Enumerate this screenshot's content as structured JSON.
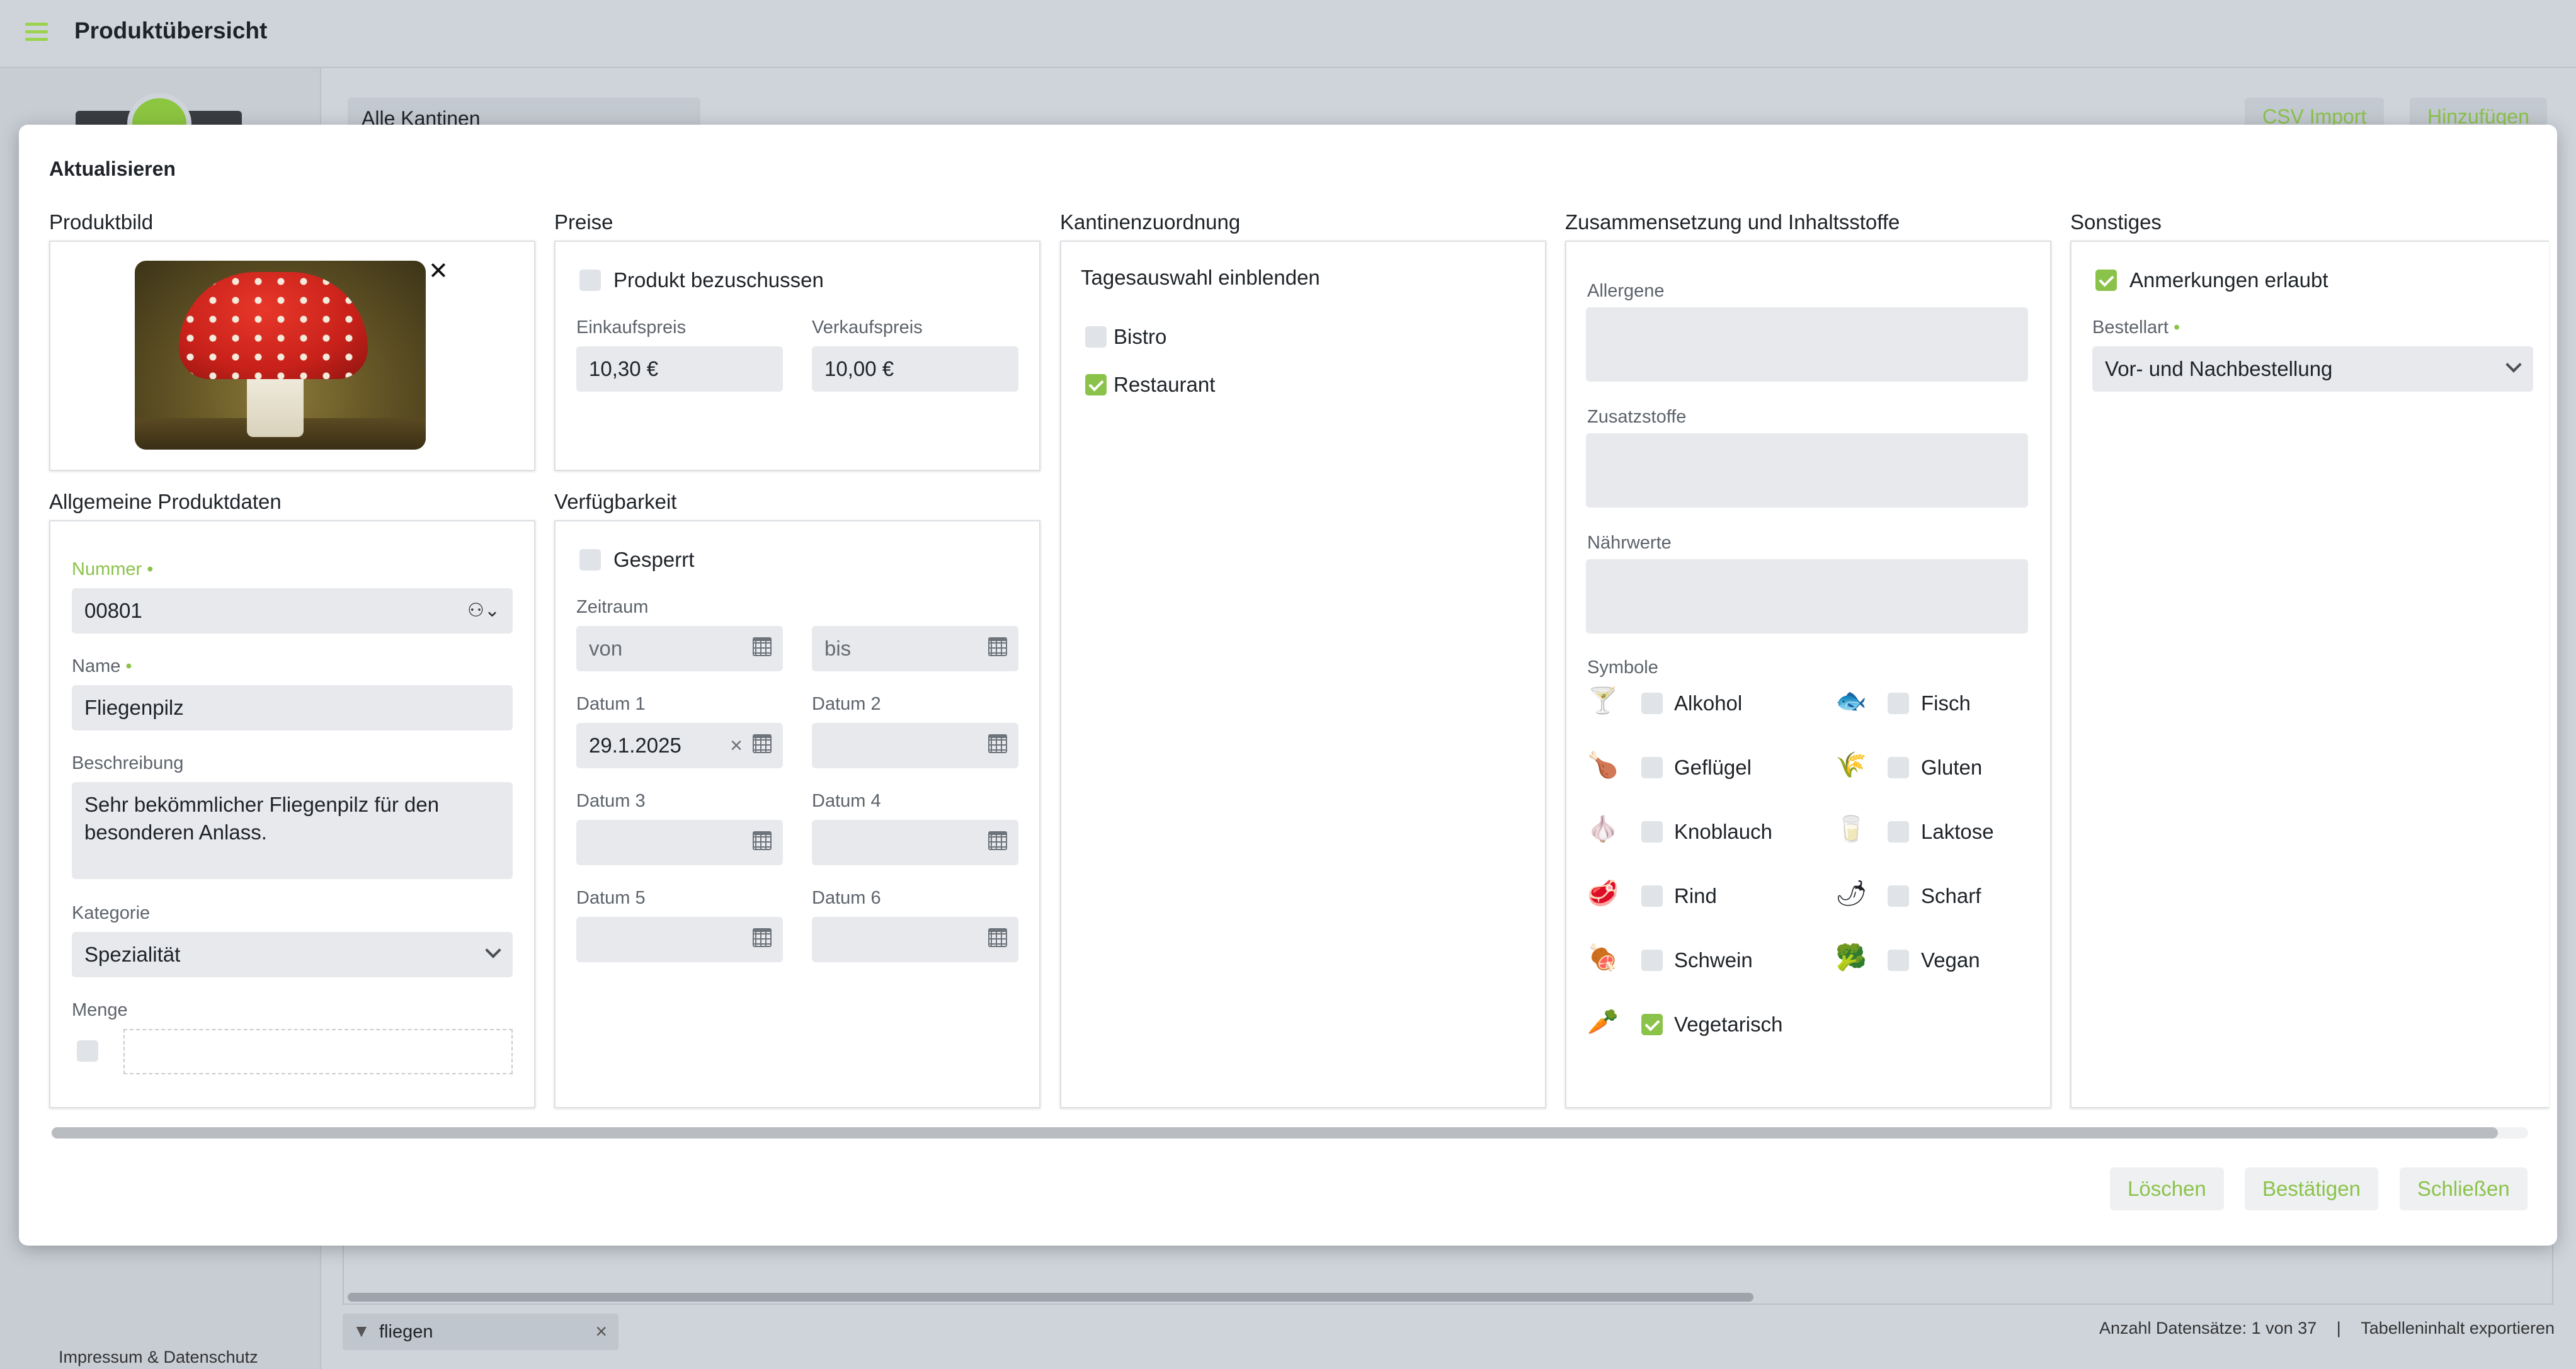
{
  "app": {
    "title": "Produktübersicht"
  },
  "sidebar": {
    "footer_link": "Impressum & Datenschutz"
  },
  "background": {
    "canteen_select": "Alle Kantinen",
    "csv_import": "CSV Import",
    "add": "Hinzufügen",
    "filter_chip": "fliegen",
    "record_count": "Anzahl Datensätze: 1 von 37",
    "separator": "|",
    "export": "Tabelleninhalt exportieren"
  },
  "modal": {
    "title": "Aktualisieren",
    "sections": {
      "image": "Produktbild",
      "prices": "Preise",
      "canteen": "Kantinenzuordnung",
      "composition": "Zusammensetzung und Inhaltsstoffe",
      "misc": "Sonstiges",
      "general": "Allgemeine Produktdaten",
      "availability": "Verfügbarkeit"
    },
    "prices": {
      "subsidize_label": "Produkt bezuschussen",
      "subsidize_checked": false,
      "purchase_label": "Einkaufspreis",
      "purchase_value": "10,30 €",
      "sale_label": "Verkaufspreis",
      "sale_value": "10,00 €"
    },
    "canteen": {
      "daily_selection": "Tagesauswahl einblenden",
      "items": [
        {
          "label": "Bistro",
          "checked": false
        },
        {
          "label": "Restaurant",
          "checked": true
        }
      ]
    },
    "composition": {
      "allergens_label": "Allergene",
      "additives_label": "Zusatzstoffe",
      "nutrition_label": "Nährwerte",
      "symbols_label": "Symbole",
      "symbols": [
        {
          "label": "Alkohol",
          "checked": false,
          "icon": "cocktail-icon"
        },
        {
          "label": "Fisch",
          "checked": false,
          "icon": "fish-icon"
        },
        {
          "label": "Geflügel",
          "checked": false,
          "icon": "poultry-icon"
        },
        {
          "label": "Gluten",
          "checked": false,
          "icon": "wheat-icon"
        },
        {
          "label": "Knoblauch",
          "checked": false,
          "icon": "garlic-icon"
        },
        {
          "label": "Laktose",
          "checked": false,
          "icon": "milk-icon"
        },
        {
          "label": "Rind",
          "checked": false,
          "icon": "steak-icon"
        },
        {
          "label": "Scharf",
          "checked": false,
          "icon": "chili-icon"
        },
        {
          "label": "Schwein",
          "checked": false,
          "icon": "ham-icon"
        },
        {
          "label": "Vegan",
          "checked": false,
          "icon": "broccoli-icon"
        },
        {
          "label": "Vegetarisch",
          "checked": true,
          "icon": "carrot-icon"
        }
      ]
    },
    "misc": {
      "comments_label": "Anmerkungen erlaubt",
      "comments_checked": true,
      "order_type_label": "Bestellart",
      "order_type_value": "Vor- und Nachbestellung"
    },
    "general": {
      "number_label": "Nummer",
      "number_value": "00801",
      "name_label": "Name",
      "name_value": "Fliegenpilz",
      "description_label": "Beschreibung",
      "description_value": "Sehr bekömmlicher Fliegenpilz für den besonderen Anlass.",
      "category_label": "Kategorie",
      "category_value": "Spezialität",
      "quantity_label": "Menge"
    },
    "availability": {
      "locked_label": "Gesperrt",
      "period_label": "Zeitraum",
      "from_placeholder": "von",
      "to_placeholder": "bis",
      "date1_label": "Datum 1",
      "date1_value": "29.1.2025",
      "date2_label": "Datum 2",
      "date3_label": "Datum 3",
      "date4_label": "Datum 4",
      "date5_label": "Datum 5",
      "date6_label": "Datum 6"
    },
    "buttons": {
      "delete": "Löschen",
      "confirm": "Bestätigen",
      "close": "Schließen"
    },
    "required_marker": "•",
    "close_glyph": "✕"
  },
  "colors": {
    "accent": "#8bc34a",
    "overlay": "#cfd4db",
    "field": "#e7e9ec"
  }
}
